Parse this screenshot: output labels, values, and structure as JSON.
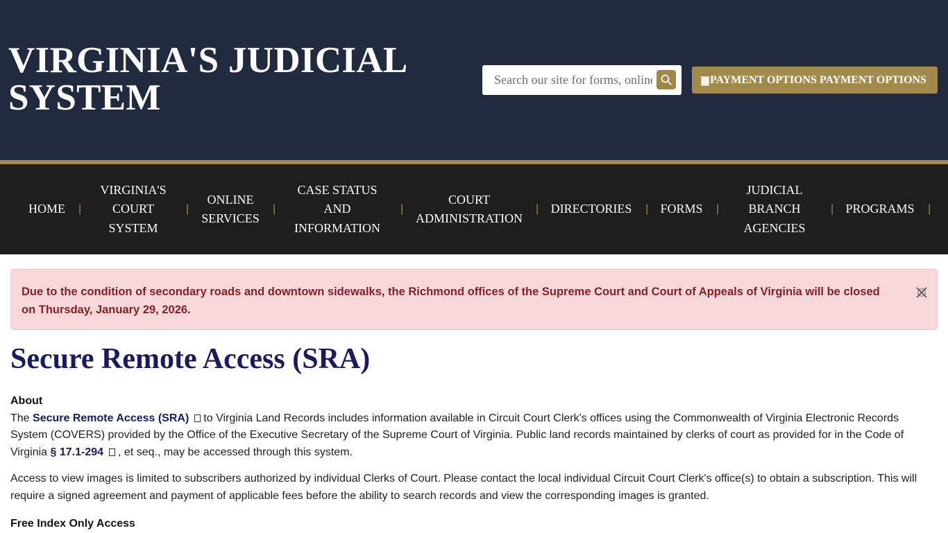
{
  "header": {
    "title_line1": "VIRGINIA'S JUDICIAL",
    "title_line2": "SYSTEM",
    "search": {
      "placeholder": "Search our site for forms, online services, and more"
    },
    "payment_button": {
      "img_alt": "PAYMENT OPTIONS",
      "label": "PAYMENT OPTIONS"
    }
  },
  "nav": {
    "items": [
      {
        "label": "HOME"
      },
      {
        "label": "VIRGINIA'S COURT SYSTEM"
      },
      {
        "label": "ONLINE SERVICES"
      },
      {
        "label": "CASE STATUS AND INFORMATION"
      },
      {
        "label": "COURT ADMINISTRATION"
      },
      {
        "label": "DIRECTORIES"
      },
      {
        "label": "FORMS"
      },
      {
        "label": "JUDICIAL BRANCH AGENCIES"
      },
      {
        "label": "PROGRAMS"
      }
    ],
    "separator": "|"
  },
  "alert": {
    "message": "Due to the condition of secondary roads and downtown sidewalks, the Richmond offices of the Supreme Court and Court of Appeals of Virginia will be closed on Thursday, January 29, 2026."
  },
  "main": {
    "title": "Secure Remote Access (SRA)",
    "about_heading": "About",
    "about_pre": "The ",
    "sra_link": "Secure Remote Access (SRA)",
    "about_mid": "to Virginia Land Records includes information available in Circuit Court Clerk's offices using the Commonwealth of Virginia Electronic Records System (COVERS) provided by the Office of the Executive Secretary of the Supreme Court of Virginia. Public land records maintained by clerks of court as provided for in the Code of Virginia ",
    "code_link": "§ 17.1-294",
    "about_post": ", et seq., may be accessed through this system.",
    "access_paragraph": "Access to view images is limited to subscribers authorized by individual Clerks of Court. Please contact the local individual Circuit Court Clerk's office(s) to obtain a subscription. This will require a signed agreement and payment of applicable fees before the ability to search records and view the corresponding images is granted.",
    "free_heading": "Free Index Only Access"
  },
  "colors": {
    "header_bg": "#212a3e",
    "accent_gold": "#a18a4c",
    "nav_bg": "#1e1e1e",
    "alert_bg": "#f8d7da",
    "alert_text": "#842029",
    "title_navy": "#1a1a5e"
  },
  "icons": {
    "search": "search-icon",
    "close": "close-icon",
    "external": "external-link-icon"
  }
}
